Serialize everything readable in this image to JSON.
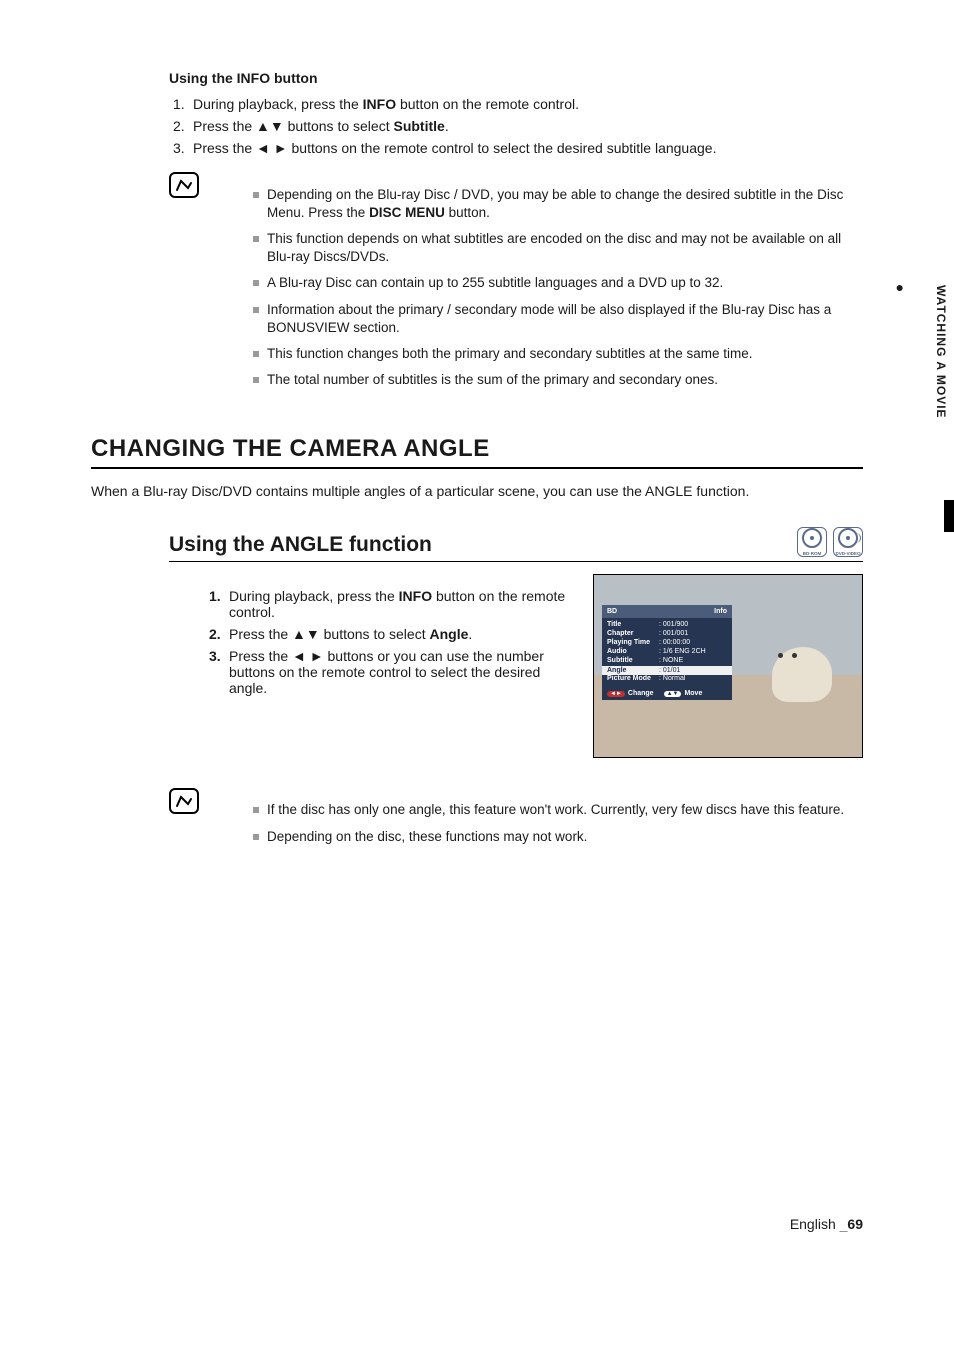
{
  "sideTab": "WATCHING A MOVIE",
  "section1": {
    "subhead": "Using the INFO button",
    "steps": [
      {
        "pre": "During playback, press the ",
        "bold": "INFO",
        "post": " button on the remote control."
      },
      {
        "pre": "Press the ▲▼ buttons to select ",
        "bold": "Subtitle",
        "post": "."
      },
      {
        "pre": "Press the ◄ ► buttons on the remote control to select the desired subtitle language.",
        "bold": "",
        "post": ""
      }
    ],
    "notes": [
      "Depending on the Blu-ray Disc / DVD, you may be able to change the desired subtitle in the Disc Menu. Press the <b>DISC MENU</b> button.",
      "This function depends on what subtitles are encoded on the disc and may not be available on all Blu-ray Discs/DVDs.",
      "A Blu-ray Disc can contain up to 255 subtitle languages and a DVD up to 32.",
      "Information about the primary / secondary mode will be also displayed if the Blu-ray Disc has a BONUSVIEW section.",
      "This function changes both the primary and secondary subtitles at the same time.",
      "The total number of subtitles is the sum of the primary and secondary ones."
    ]
  },
  "h1": "CHANGING THE CAMERA ANGLE",
  "lead": "When a Blu-ray Disc/DVD contains multiple angles of a particular scene, you can use the ANGLE function.",
  "section2": {
    "h2": "Using the ANGLE function",
    "discs": [
      "BD-ROM",
      "DVD-VIDEO"
    ],
    "steps": [
      {
        "pre": "During playback, press the ",
        "bold": "INFO",
        "post": " button on the remote control."
      },
      {
        "pre": "Press the ▲▼ buttons to select ",
        "bold": "Angle",
        "post": "."
      },
      {
        "pre": "Press the ◄ ► buttons or you can use the number buttons on the remote control to select the desired angle.",
        "bold": "",
        "post": ""
      }
    ],
    "notes": [
      "If the disc has only one angle, this feature won't work. Currently, very few discs have this feature.",
      "Depending on the disc, these functions may not work."
    ]
  },
  "osd": {
    "headL": "BD",
    "headR": "Info",
    "rows": [
      {
        "k": "Title",
        "v": "001/900"
      },
      {
        "k": "Chapter",
        "v": "001/001"
      },
      {
        "k": "Playing Time",
        "v": "00:00:00"
      },
      {
        "k": "Audio",
        "v": "1/6 ENG 2CH"
      },
      {
        "k": "Subtitle",
        "v": "NONE"
      },
      {
        "k": "Angle",
        "v": "01/01",
        "hl": true
      },
      {
        "k": "Picture Mode",
        "v": "Normal"
      }
    ],
    "footChange": "Change",
    "footMove": "Move"
  },
  "footer": {
    "lang": "English",
    "sep": "_",
    "page": "69"
  }
}
